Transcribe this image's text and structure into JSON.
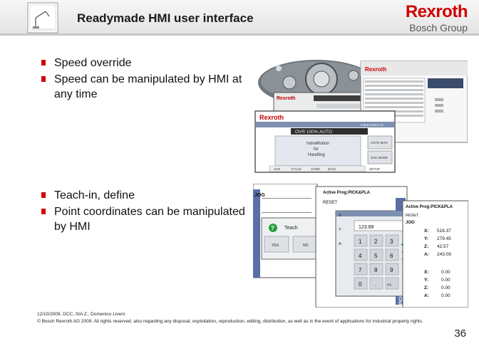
{
  "header": {
    "title": "Readymade HMI user interface",
    "brand": "Rexroth",
    "brand_group": "Bosch Group"
  },
  "sections": [
    {
      "bullets": [
        "Speed override",
        "Speed can be manipulated by HMI at any time"
      ]
    },
    {
      "bullets": [
        "Teach-in, define",
        "Point coordinates can be manipulated by HMI"
      ]
    }
  ],
  "screens_top": {
    "pendant_label": "Rexroth",
    "hmi_header": "Rexroth",
    "hmi_product": "IndraControl VC",
    "status_bar": "OVR 100%  AUTO",
    "main_text": [
      "IndraMotion",
      "for",
      "Handling"
    ],
    "side_buttons": [
      "AUTO MAN",
      "JOG MODE"
    ],
    "bottom_tabs": [
      "JOG",
      "CYCLE",
      "CODE",
      "DIAG"
    ],
    "setup_label": "SETUP",
    "rexroth_small": "Rexroth",
    "editor_values": [
      "0000",
      "0000",
      "0000"
    ]
  },
  "screens_bottom": {
    "prog_title_left": "Active Prog:PICK&PLA",
    "prog_title_right": "Active Prog:PICK&PLA",
    "reset_label": "RESET",
    "jog_label": "JOG",
    "pick_label": "PICK",
    "teach_label": "Teach",
    "yes_label": "YES",
    "no_label": "NO",
    "input_value": "123.89",
    "keypad": [
      "1",
      "2",
      "3",
      "4",
      "5",
      "6",
      "7",
      "8",
      "9",
      "0",
      ".",
      "+/-"
    ],
    "coords_top": [
      {
        "axis": "X:",
        "value": "516.37"
      },
      {
        "axis": "Y:",
        "value": "279.45"
      },
      {
        "axis": "Z:",
        "value": "42.57"
      },
      {
        "axis": "A:",
        "value": "243.09"
      }
    ],
    "coords_bottom": [
      {
        "axis": "X:",
        "value": "0.00"
      },
      {
        "axis": "Y:",
        "value": "0.00"
      },
      {
        "axis": "Z:",
        "value": "0.00"
      },
      {
        "axis": "A:",
        "value": "0.00"
      }
    ]
  },
  "footer": {
    "line1": "12/10/2009, DCC, SIA Z., Domenico Liveni",
    "line2": "© Bosch Rexroth AG 2009. All rights reserved, also regarding any disposal, exploitation, reproduction, editing, distribution, as well as in the event of applications for industrial property rights.",
    "page": "36"
  }
}
